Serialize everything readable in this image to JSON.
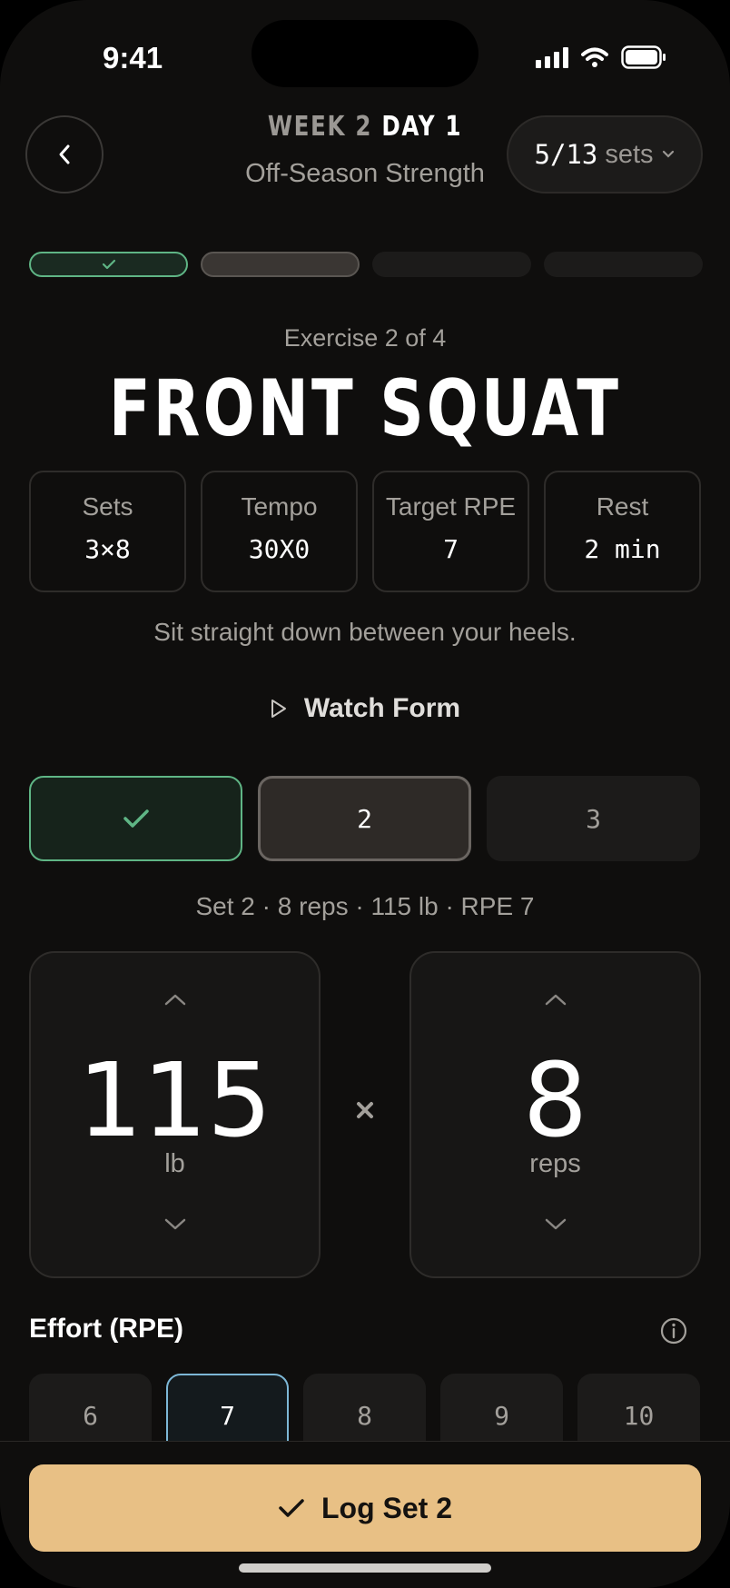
{
  "status_bar": {
    "time": "9:41"
  },
  "header": {
    "week": "WEEK 2",
    "day": "DAY 1",
    "program": "Off-Season Strength",
    "sets_progress": "5/13",
    "sets_word": "sets"
  },
  "exercise_progress": [
    "done",
    "current",
    "todo",
    "todo"
  ],
  "exercise": {
    "counter": "Exercise 2 of 4",
    "name": "FRONT SQUAT",
    "stats": [
      {
        "label": "Sets",
        "value": "3×8"
      },
      {
        "label": "Tempo",
        "value": "30X0"
      },
      {
        "label": "Target RPE",
        "value": "7"
      },
      {
        "label": "Rest",
        "value": "2 min"
      }
    ],
    "cue": "Sit straight down between your heels.",
    "watch_label": "Watch Form"
  },
  "sets": [
    {
      "label": "",
      "state": "done"
    },
    {
      "label": "2",
      "state": "current"
    },
    {
      "label": "3",
      "state": "todo"
    }
  ],
  "set_summary": "Set 2 · 8 reps · 115 lb · RPE 7",
  "weight": {
    "value": "115",
    "unit": "lb"
  },
  "reps": {
    "value": "8",
    "unit": "reps"
  },
  "effort": {
    "title": "Effort (RPE)",
    "options": [
      "6",
      "7",
      "8",
      "9",
      "10"
    ],
    "selected": "7"
  },
  "log_button": {
    "label": "Log Set 2"
  },
  "colors": {
    "accent": "#e8c085",
    "done_green": "#5fb585",
    "selected_blue": "#7db7d6"
  }
}
